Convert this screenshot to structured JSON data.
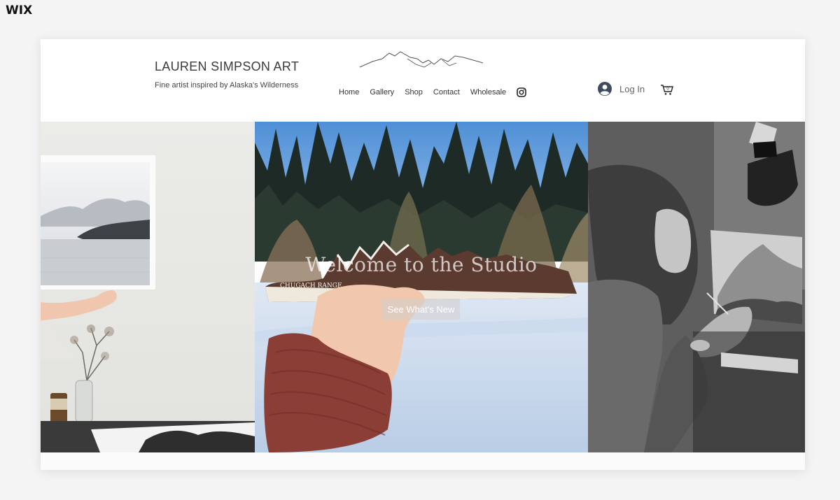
{
  "platform": {
    "logo_text": "WIX"
  },
  "header": {
    "title": "LAUREN SIMPSON ART",
    "tagline": "Fine artist inspired by Alaska's Wilderness",
    "nav": [
      "Home",
      "Gallery",
      "Shop",
      "Contact",
      "Wholesale"
    ],
    "social_icon": "instagram-icon",
    "login_label": "Log In",
    "cart_count": "0"
  },
  "hero": {
    "title": "Welcome to the Studio",
    "button_label": "See What's New",
    "sticker_text": "CHUGACH RANGE"
  }
}
